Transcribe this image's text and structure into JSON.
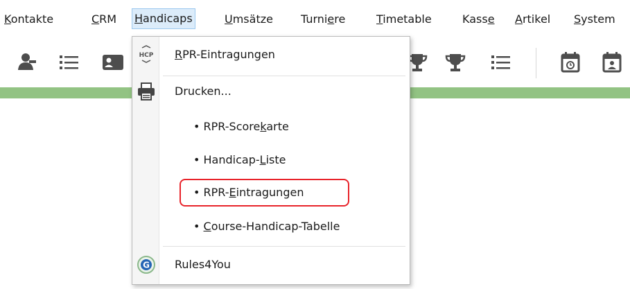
{
  "menubar": {
    "items": [
      {
        "pre": "",
        "ul": "K",
        "post": "ontakte"
      },
      {
        "pre": "",
        "ul": "C",
        "post": "RM"
      },
      {
        "pre": "",
        "ul": "H",
        "post": "andicaps"
      },
      {
        "pre": "",
        "ul": "U",
        "post": "msätze"
      },
      {
        "pre": "Turni",
        "ul": "e",
        "post": "re"
      },
      {
        "pre": "",
        "ul": "T",
        "post": "imetable"
      },
      {
        "pre": "Kass",
        "ul": "e",
        "post": ""
      },
      {
        "pre": "",
        "ul": "A",
        "post": "rtikel"
      },
      {
        "pre": "",
        "ul": "S",
        "post": "ystem"
      }
    ]
  },
  "toolbar": {
    "icons": [
      "contacts-icon",
      "list-icon",
      "contact-card-icon",
      "trophy-icon",
      "trophy-icon",
      "list-icon",
      "calendar-clock-icon",
      "calendar-person-icon"
    ]
  },
  "dropdown": {
    "items": [
      {
        "pre": "",
        "ul": "R",
        "post": "PR-Eintragungen",
        "icon": "hcp-icon",
        "icon_text": "HCP"
      },
      {
        "pre": "Drucken...",
        "ul": "",
        "post": "",
        "icon": "printer-icon"
      },
      {
        "pre": "• RPR-Score",
        "ul": "k",
        "post": "arte"
      },
      {
        "pre": "• Handicap-",
        "ul": "L",
        "post": "iste"
      },
      {
        "pre": "• RPR-",
        "ul": "E",
        "post": "intragungen"
      },
      {
        "pre": "• ",
        "ul": "C",
        "post": "ourse-Handicap-Tabelle"
      },
      {
        "pre": "Rules4You",
        "ul": "",
        "post": "",
        "icon": "rules4you-icon",
        "icon_text": "G"
      }
    ]
  },
  "colors": {
    "green_bar": "#92c383",
    "highlight": "#e8232a",
    "active_menu_bg": "#dcecfa"
  }
}
